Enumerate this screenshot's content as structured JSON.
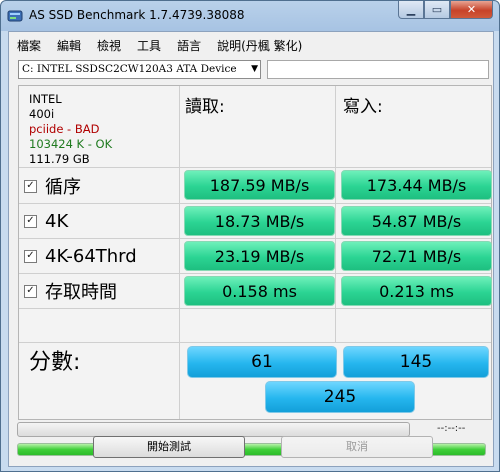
{
  "window": {
    "title": "AS SSD Benchmark 1.7.4739.38088",
    "minimize": "▁",
    "maximize": "▭",
    "close": "✕"
  },
  "menu": [
    "檔案",
    "編輯",
    "檢視",
    "工具",
    "語言",
    "說明(丹楓 繁化)"
  ],
  "device": {
    "selected": "C: INTEL SSDSC2CW120A3 ATA Device",
    "arrow": "▼"
  },
  "info": {
    "vendor": "INTEL",
    "firmware": "400i",
    "driver": "pciide - BAD",
    "alignment": "103424 K - OK",
    "capacity": "111.79 GB"
  },
  "columns": {
    "read": "讀取:",
    "write": "寫入:"
  },
  "tests": [
    {
      "label": "循序",
      "checked": "✓",
      "read": "187.59 MB/s",
      "write": "173.44 MB/s"
    },
    {
      "label": "4K",
      "checked": "✓",
      "read": "18.73 MB/s",
      "write": "54.87 MB/s"
    },
    {
      "label": "4K-64Thrd",
      "checked": "✓",
      "read": "23.19 MB/s",
      "write": "72.71 MB/s"
    },
    {
      "label": "存取時間",
      "checked": "✓",
      "read": "0.158 ms",
      "write": "0.213 ms"
    }
  ],
  "score": {
    "label": "分數:",
    "read": "61",
    "write": "145",
    "total": "245"
  },
  "progress": {
    "elapsed": "--:--:--",
    "top_fill": 0,
    "bottom_fill": 1.0
  },
  "buttons": {
    "start": "開始測試",
    "cancel": "取消"
  }
}
